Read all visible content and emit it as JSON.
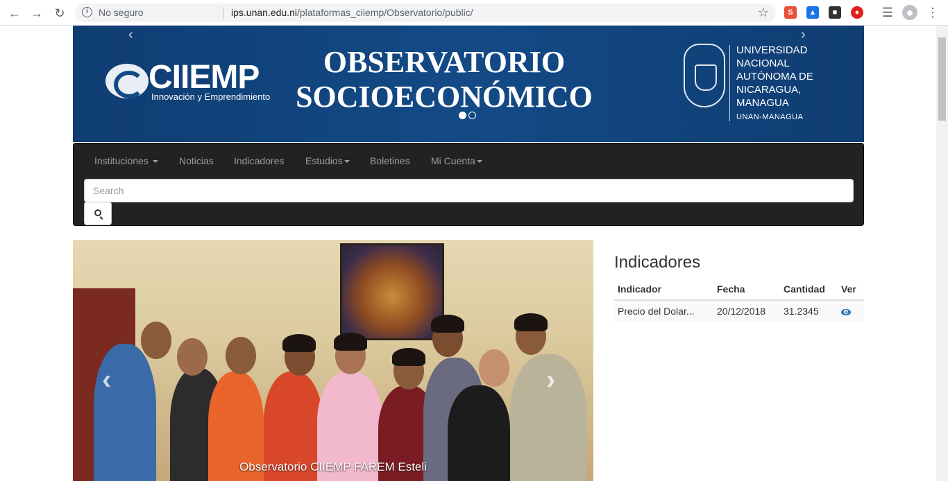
{
  "browser": {
    "security_label": "No seguro",
    "url_host": "ips.unan.edu.ni",
    "url_path": "/plataformas_ciiemp/Observatorio/public/",
    "icons": [
      "back-icon",
      "forward-icon",
      "reload-icon",
      "info-icon",
      "star-icon",
      "extension-icons",
      "media-icon",
      "profile-icon",
      "menu-icon"
    ]
  },
  "banner": {
    "ciiemp_name": "CIIEMP",
    "ciiemp_tagline": "Innovación y Emprendimiento",
    "title_line1": "OBSERVATORIO",
    "title_line2": "SOCIOECONÓMICO",
    "unan_line1": "UNIVERSIDAD",
    "unan_line2": "NACIONAL",
    "unan_line3": "AUTÓNOMA DE",
    "unan_line4": "NICARAGUA,",
    "unan_line5": "MANAGUA",
    "unan_abbr": "UNAN-MANAGUA",
    "prev_arrow": "‹",
    "next_arrow": "›"
  },
  "navbar": {
    "items": [
      "Instituciones",
      "Noticias",
      "Indicadores",
      "Estudios",
      "Boletines",
      "Mi Cuenta"
    ],
    "search_placeholder": "Search"
  },
  "carousel": {
    "caption": "Observatorio CIIEMP FAREM Esteli",
    "prev_arrow": "‹",
    "next_arrow": "›"
  },
  "indicadores": {
    "title": "Indicadores",
    "headers": [
      "Indicador",
      "Fecha",
      "Cantidad",
      "Ver"
    ],
    "rows": [
      [
        "Precio del Dolar...",
        "20/12/2018",
        "31.2345"
      ]
    ]
  },
  "colors": {
    "banner_blue": "#134a86",
    "navbar_dark": "#222222",
    "link_blue": "#337ab7"
  }
}
